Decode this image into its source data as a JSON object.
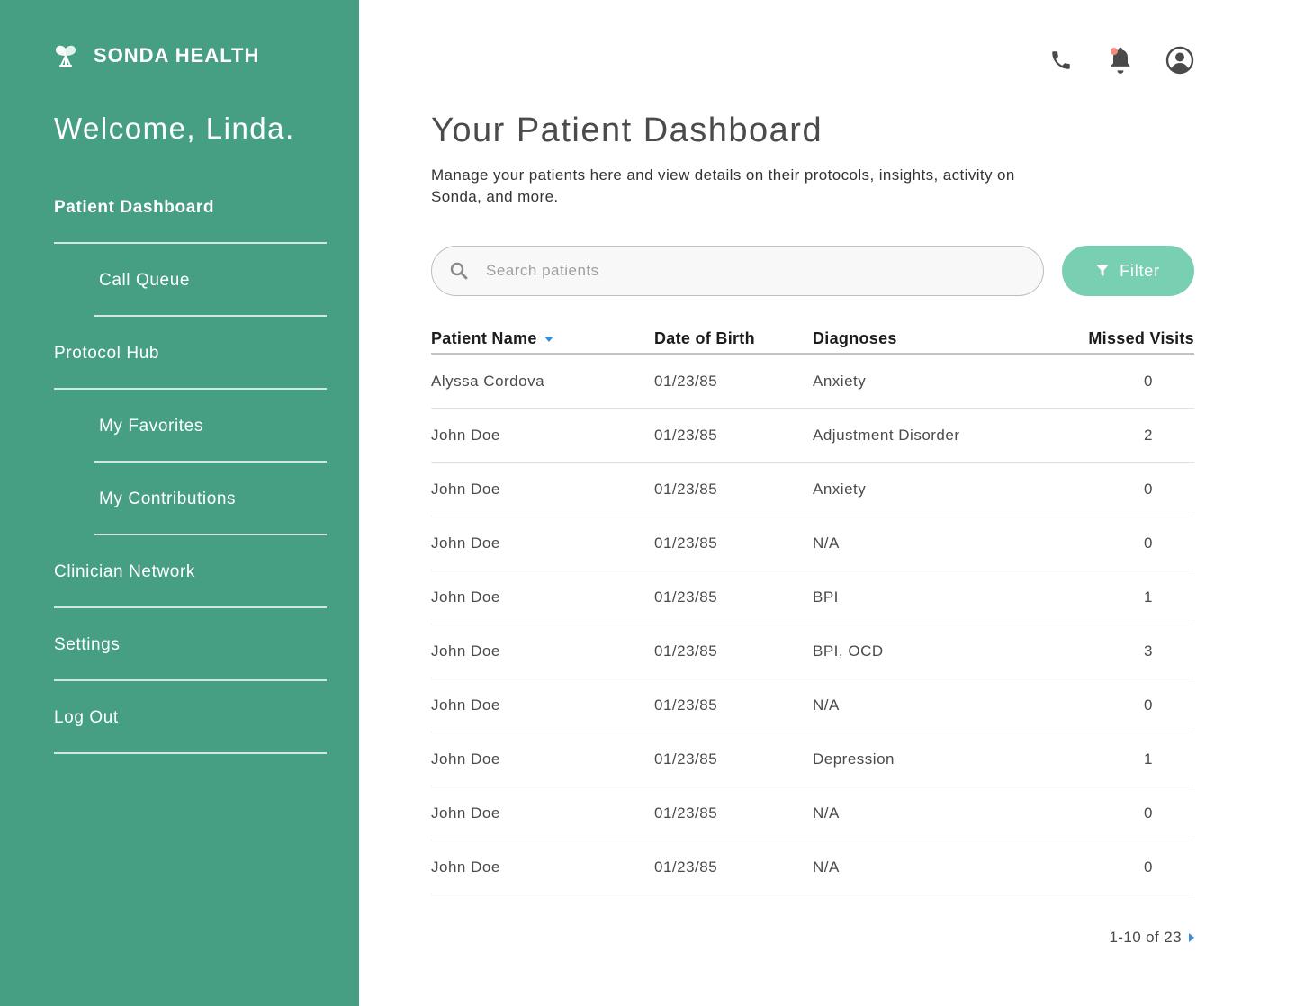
{
  "brand": {
    "name": "SONDA HEALTH"
  },
  "sidebar": {
    "welcome": "Welcome, Linda.",
    "items": [
      {
        "label": "Patient Dashboard",
        "level": "top",
        "active": true
      },
      {
        "label": "Call Queue",
        "level": "sub"
      },
      {
        "label": "Protocol Hub",
        "level": "top"
      },
      {
        "label": "My Favorites",
        "level": "sub"
      },
      {
        "label": "My Contributions",
        "level": "sub"
      },
      {
        "label": "Clinician Network",
        "level": "top"
      },
      {
        "label": "Settings",
        "level": "top"
      },
      {
        "label": "Log Out",
        "level": "top"
      }
    ]
  },
  "header": {
    "icons": [
      "phone-icon",
      "bell-icon",
      "user-account-icon"
    ]
  },
  "main": {
    "title": "Your Patient Dashboard",
    "description": "Manage your patients here and view details on their protocols, insights, activity on Sonda, and more.",
    "search": {
      "placeholder": "Search patients",
      "value": ""
    },
    "filter_label": "Filter"
  },
  "table": {
    "columns": [
      "Patient Name",
      "Date of Birth",
      "Diagnoses",
      "Missed Visits"
    ],
    "rows": [
      [
        "Alyssa Cordova",
        "01/23/85",
        "Anxiety",
        "0"
      ],
      [
        "John Doe",
        "01/23/85",
        "Adjustment Disorder",
        "2"
      ],
      [
        "John Doe",
        "01/23/85",
        "Anxiety",
        "0"
      ],
      [
        "John Doe",
        "01/23/85",
        "N/A",
        "0"
      ],
      [
        "John Doe",
        "01/23/85",
        "BPI",
        "1"
      ],
      [
        "John Doe",
        "01/23/85",
        "BPI, OCD",
        "3"
      ],
      [
        "John Doe",
        "01/23/85",
        "N/A",
        "0"
      ],
      [
        "John Doe",
        "01/23/85",
        "Depression",
        "1"
      ],
      [
        "John Doe",
        "01/23/85",
        "N/A",
        "0"
      ],
      [
        "John Doe",
        "01/23/85",
        "N/A",
        "0"
      ]
    ]
  },
  "pagination": {
    "label": "1-10 of 23"
  },
  "colors": {
    "sidebar": "#479f83",
    "filter_button": "#78cfb1",
    "accent_blue": "#3b8ad9",
    "notification_dot": "#ee8c7d"
  }
}
